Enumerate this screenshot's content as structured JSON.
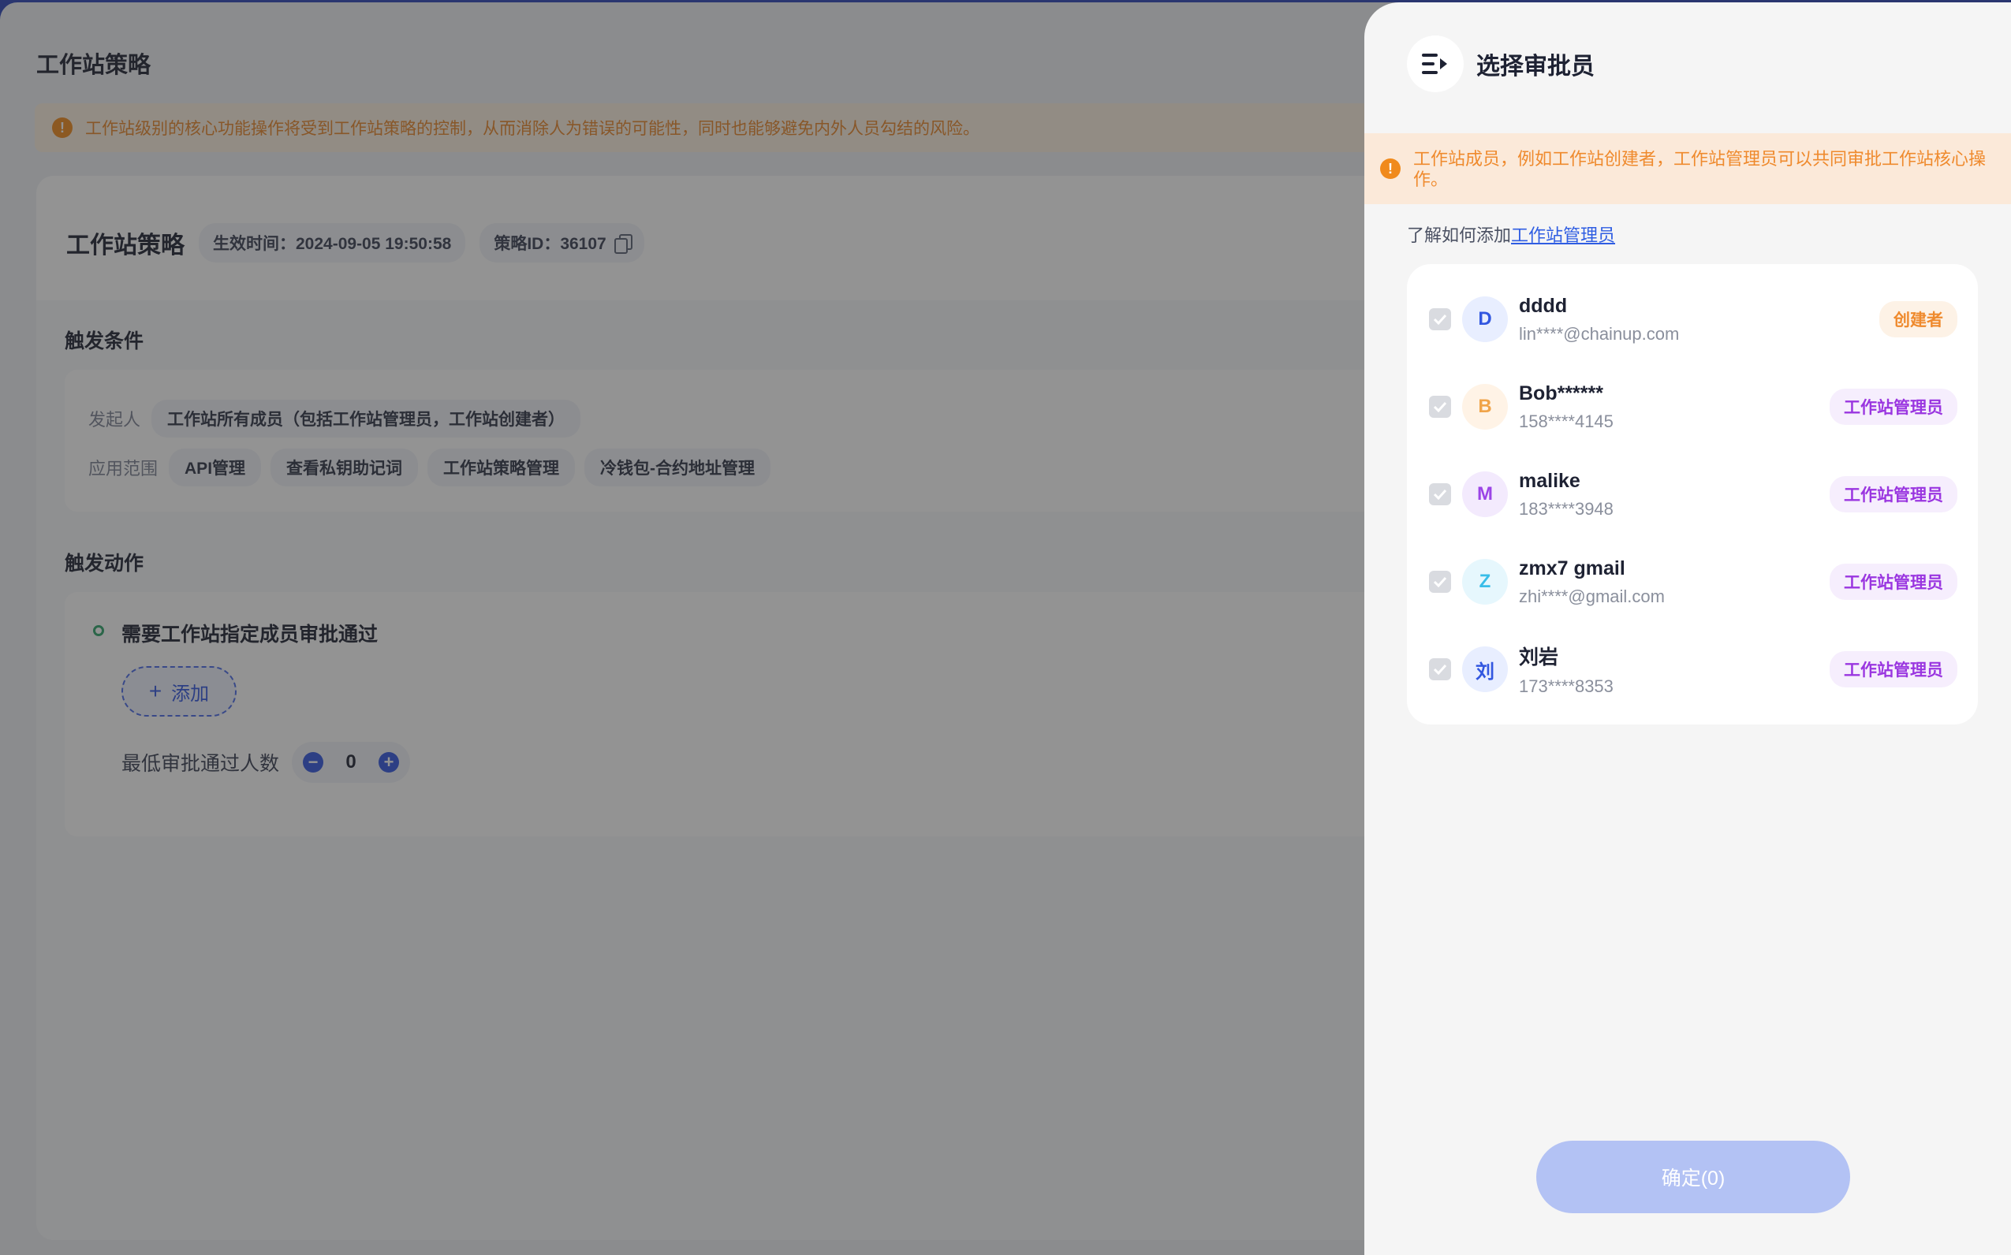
{
  "background": {
    "page_title": "工作站策略",
    "notice": "工作站级别的核心功能操作将受到工作站策略的控制，从而消除人为错误的可能性，同时也能够避免内外人员勾结的风险。",
    "policy": {
      "title": "工作站策略",
      "effective_time": "生效时间：2024-09-05 19:50:58",
      "policy_id": "策略ID：36107"
    },
    "trigger_conditions": {
      "title": "触发条件",
      "initiator_label": "发起人",
      "initiator_value": "工作站所有成员（包括工作站管理员，工作站创建者）",
      "scope_label": "应用范围",
      "scope_items": [
        "API管理",
        "查看私钥助记词",
        "工作站策略管理",
        "冷钱包-合约地址管理"
      ]
    },
    "trigger_actions": {
      "title": "触发动作",
      "action_title": "需要工作站指定成员审批通过",
      "add_label": "添加",
      "min_label": "最低审批通过人数",
      "min_value": "0"
    }
  },
  "drawer": {
    "title": "选择审批员",
    "notice": "工作站成员，例如工作站创建者，工作站管理员可以共同审批工作站核心操作。",
    "learn_prefix": "了解如何添加",
    "learn_link": "工作站管理员",
    "members": [
      {
        "initial": "D",
        "name": "dddd",
        "contact": "lin****@chainup.com",
        "role": "创建者",
        "role_type": "creator",
        "avatar_color": "#3257e0",
        "avatar_bg": "#e8eeff"
      },
      {
        "initial": "B",
        "name": "Bob******",
        "contact": "158****4145",
        "role": "工作站管理员",
        "role_type": "admin",
        "avatar_color": "#f0a44a",
        "avatar_bg": "#fff3e6"
      },
      {
        "initial": "M",
        "name": "malike",
        "contact": "183****3948",
        "role": "工作站管理员",
        "role_type": "admin",
        "avatar_color": "#9b44e6",
        "avatar_bg": "#f3eafd"
      },
      {
        "initial": "Z",
        "name": "zmx7 gmail",
        "contact": "zhi****@gmail.com",
        "role": "工作站管理员",
        "role_type": "admin",
        "avatar_color": "#38bde8",
        "avatar_bg": "#e6f7fd"
      },
      {
        "initial": "刘",
        "name": "刘岩",
        "contact": "173****8353",
        "role": "工作站管理员",
        "role_type": "admin",
        "avatar_color": "#3257e0",
        "avatar_bg": "#e8eeff"
      }
    ],
    "confirm_label": "确定(0)"
  },
  "colors": {
    "accent": "#3257e0",
    "warning": "#ef8a2d",
    "admin_badge": "#9a36e0",
    "confirm_disabled": "#b3c2f4"
  }
}
